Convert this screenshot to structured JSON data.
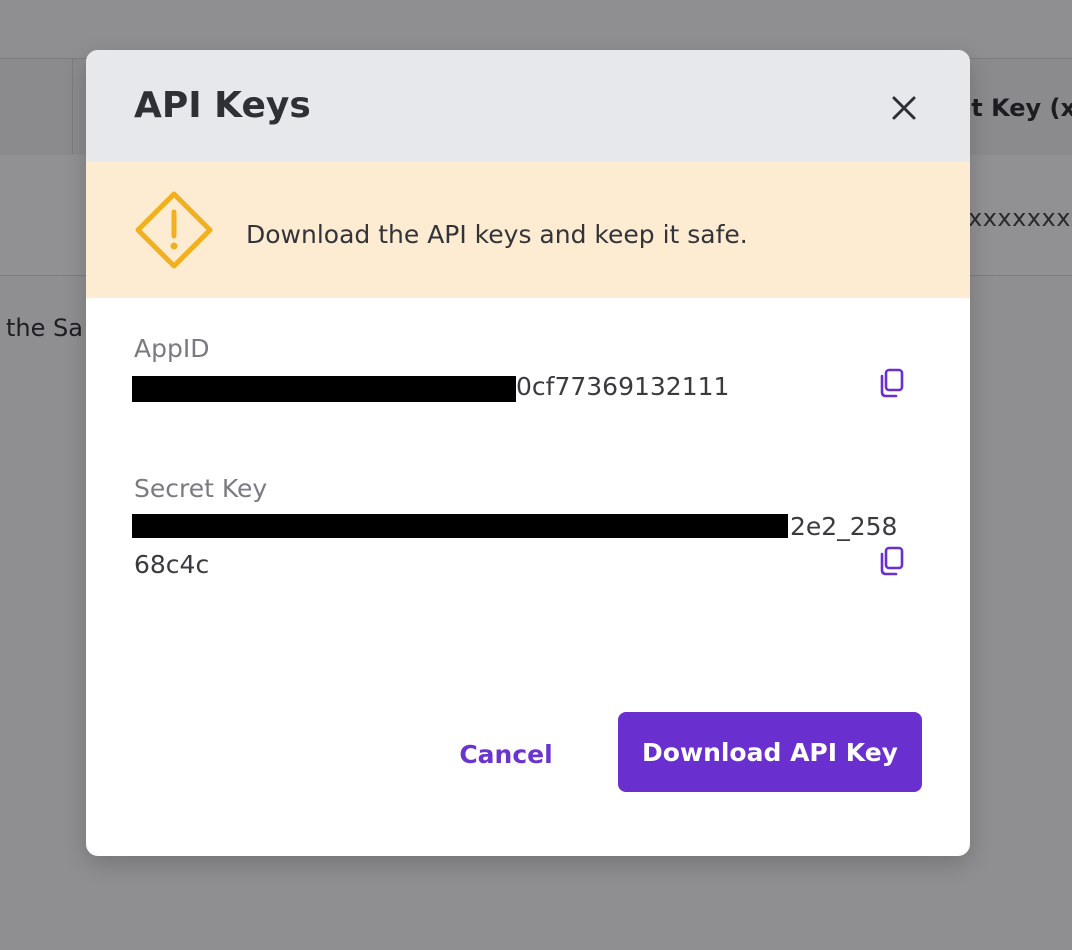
{
  "background": {
    "header_fragment": "et Key (x",
    "masked_value_fragment": "xxxxxxxx",
    "left_text_fragment": "the Sa"
  },
  "modal": {
    "title": "API Keys",
    "warning": {
      "icon": "warning-diamond-icon",
      "text": "Download the API keys and keep it safe."
    },
    "fields": {
      "app_id": {
        "label": "AppID",
        "visible_value": "0cf77369132111"
      },
      "secret_key": {
        "label": "Secret Key",
        "visible_value_line1": "2e2_258",
        "visible_value_line2": "68c4c"
      }
    },
    "buttons": {
      "cancel": "Cancel",
      "download": "Download API Key"
    }
  },
  "colors": {
    "overlay": "#8f8f91",
    "header_bg": "#e7e8ec",
    "warning_bg": "#fdecd2",
    "warning_icon": "#f2b01e",
    "accent": "#6a2fcf",
    "redaction": "#000000"
  }
}
